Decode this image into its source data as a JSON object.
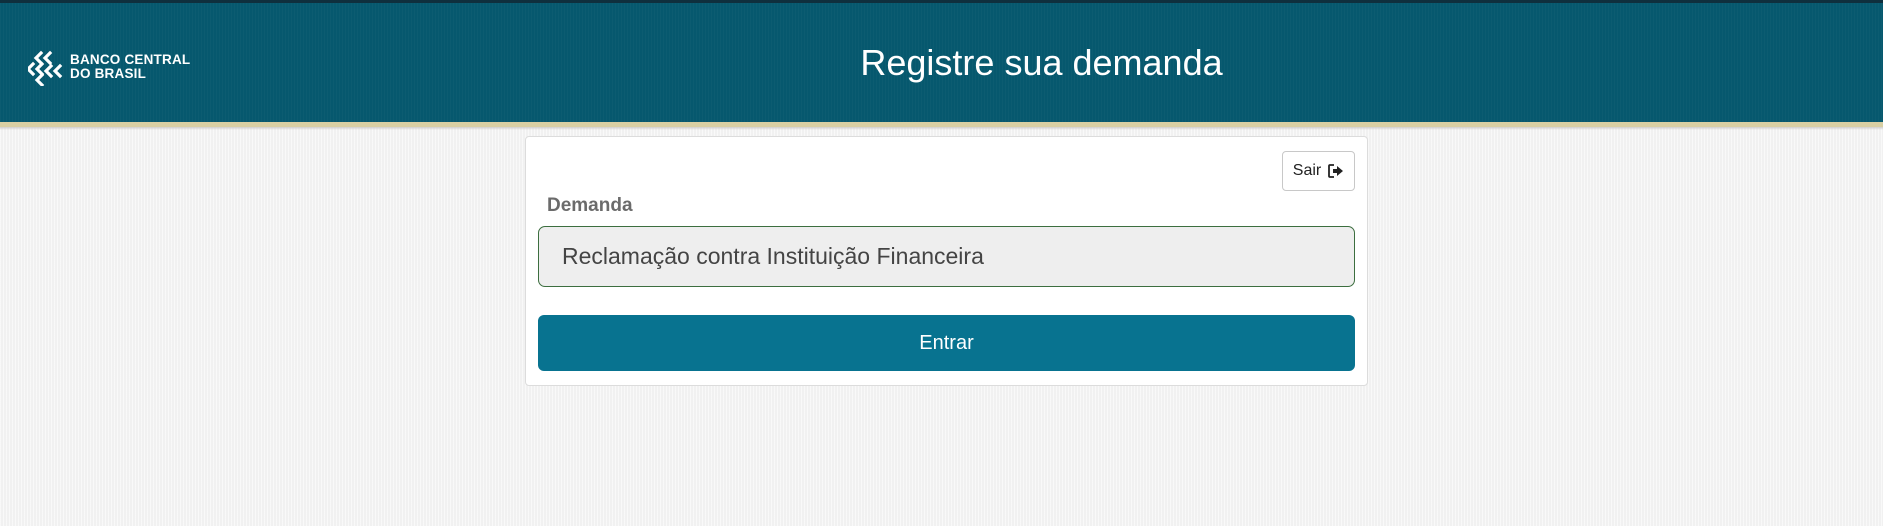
{
  "header": {
    "logo": {
      "line1": "BANCO CENTRAL",
      "line2": "DO BRASIL",
      "icon": "bcb-logo-icon"
    },
    "title": "Registre sua demanda"
  },
  "card": {
    "exit_button": {
      "label": "Sair",
      "icon": "sign-out-icon"
    },
    "demanda": {
      "label": "Demanda",
      "value": "Reclamação contra Instituição Financeira"
    },
    "submit_label": "Entrar"
  },
  "colors": {
    "header_bg": "#06586e",
    "gold_stripe": "#d8cfa3",
    "primary_button": "#087390",
    "field_border": "#3c6e3f"
  }
}
